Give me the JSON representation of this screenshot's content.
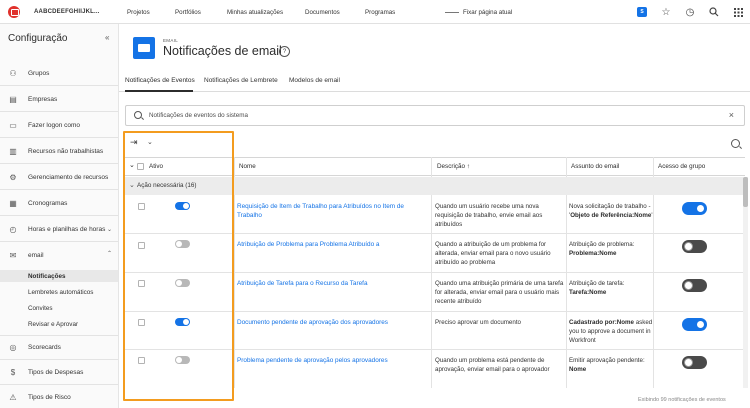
{
  "topnav": {
    "org": "AABCDEEFGHIIJKL...",
    "links": [
      "Projetos",
      "Portfólios",
      "Minhas atualizações",
      "Documentos",
      "Programas"
    ],
    "pin_label": "Fixar página atual",
    "badge": "S",
    "icons": [
      "star-icon",
      "history-icon",
      "search-icon",
      "grid-icon"
    ]
  },
  "sidebar": {
    "title": "Configuração",
    "collapse": "«",
    "items": [
      {
        "label": "Grupos",
        "icon": "groups-icon"
      },
      {
        "label": "Empresas",
        "icon": "company-icon"
      },
      {
        "label": "Fazer logon como",
        "icon": "login-icon"
      },
      {
        "label": "Recursos não trabalhistas",
        "icon": "resources-icon"
      },
      {
        "label": "Gerenciamento de recursos",
        "icon": "resource-management-icon"
      },
      {
        "label": "Cronogramas",
        "icon": "calendar-icon"
      },
      {
        "label": "Horas e planilhas de horas",
        "icon": "clock-icon"
      },
      {
        "label": "email",
        "icon": "email-icon"
      }
    ],
    "email_subitems": [
      "Notificações",
      "Lembretes automáticos",
      "Convites",
      "Revisar e Aprovar"
    ],
    "bottom_items": [
      {
        "label": "Scorecards",
        "icon": "scorecard-icon"
      },
      {
        "label": "Tipos de Despesas",
        "icon": "expense-icon"
      },
      {
        "label": "Tipos de Risco",
        "icon": "risk-icon"
      }
    ]
  },
  "header": {
    "small": "EMAIL",
    "title": "Notificações de email",
    "help": "?"
  },
  "tabs": [
    "Notificações de Eventos",
    "Notificações de Lembrete",
    "Modelos de email"
  ],
  "search": {
    "placeholder": "Notificações de eventos do sistema",
    "clear": "×"
  },
  "table": {
    "columns": [
      "Ativo",
      "Nome",
      "Descrição ↑",
      "Assunto do email",
      "Acesso de grupo"
    ],
    "group": {
      "label": "Ação necessária (16)"
    },
    "rows": [
      {
        "active": true,
        "name": "Requisição de Item de Trabalho para Atribuídos no Item de Trabalho",
        "description": "Quando um usuário recebe uma nova requisição de trabalho, envie email aos atribuídos",
        "subject_prefix": "Nova solicitação de trabalho - '",
        "subject_bold": "Objeto de Referência:Nome",
        "subject_suffix": "'",
        "group_access": true
      },
      {
        "active": false,
        "name": "Atribuição de Problema para Problema Atribuído a",
        "description": "Quando a atribuição de um problema for alterada, enviar email para o novo usuário atribuído ao problema",
        "subject_prefix": "Atribuição de problema: ",
        "subject_bold": "Problema:Nome",
        "subject_suffix": "",
        "group_access": false
      },
      {
        "active": false,
        "name": "Atribuição de Tarefa para o Recurso da Tarefa",
        "description": "Quando uma atribuição primária de uma tarefa for alterada, enviar email para o usuário mais recente atribuído",
        "subject_prefix": "Atribuição de tarefa: ",
        "subject_bold": "Tarefa:Nome",
        "subject_suffix": "",
        "group_access": false
      },
      {
        "active": true,
        "name": "Documento pendente de aprovação dos aprovadores",
        "description": "Preciso aprovar um documento",
        "subject_bold": "Cadastrado por:Nome",
        "subject_suffix": " asked you to approve a document in Workfront",
        "subject_prefix": "",
        "group_access": true
      },
      {
        "active": false,
        "name": "Problema pendente de aprovação pelos aprovadores",
        "description": "Quando um problema está pendente de aprovação, enviar email para o aprovador",
        "subject_prefix": "Emitir aprovação pendente: ",
        "subject_bold": "Nome",
        "subject_suffix": "",
        "group_access": false
      }
    ],
    "footer": "Exibindo 99 notificações de eventos"
  },
  "colors": {
    "accent": "#1473e6",
    "highlight": "#f39c1f",
    "logo": "#e0312c"
  }
}
